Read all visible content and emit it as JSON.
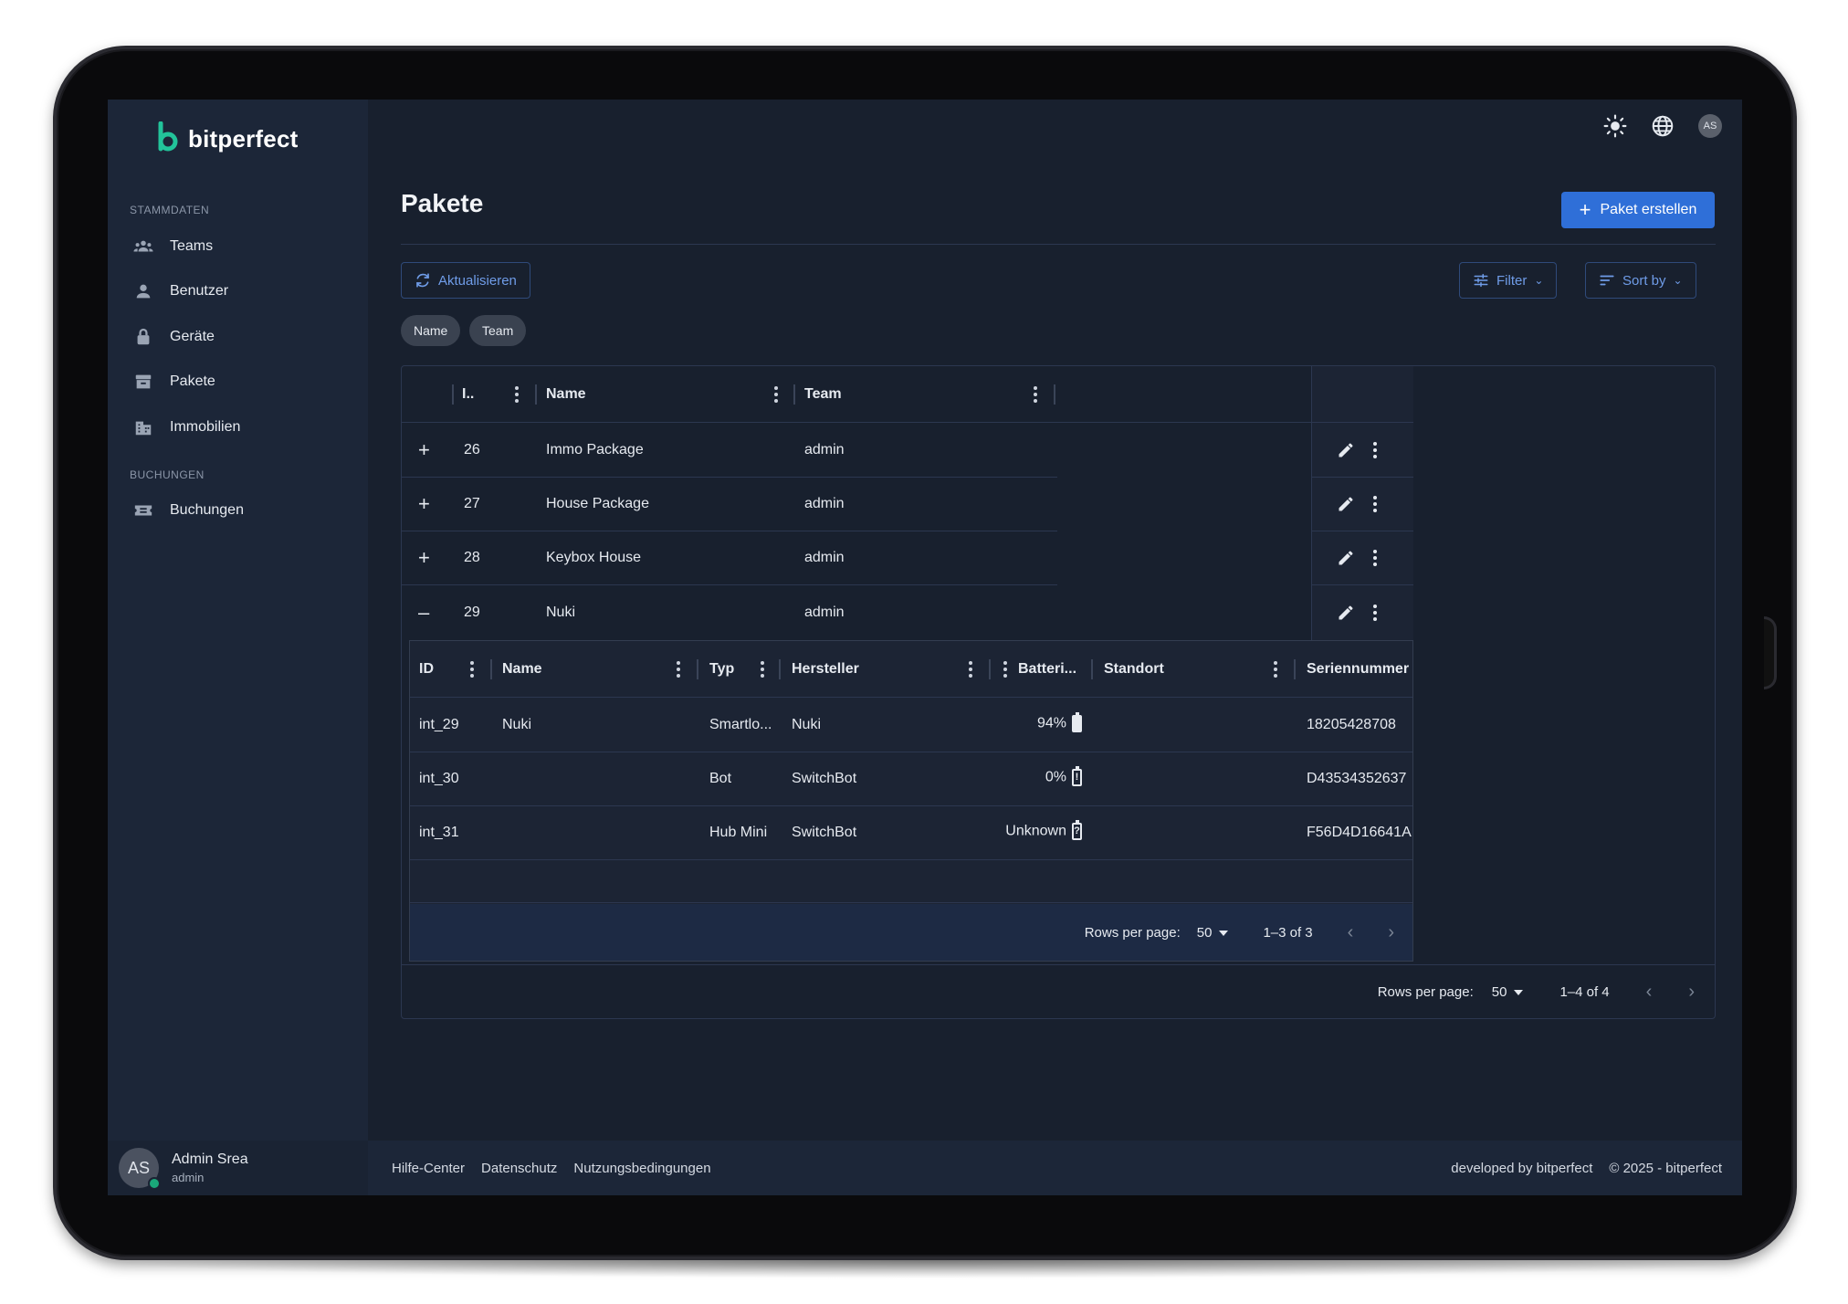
{
  "app": {
    "brand": "bitperfect",
    "user_initials": "AS"
  },
  "sidebar": {
    "sections": [
      {
        "label": "STAMMDATEN",
        "items": [
          {
            "label": "Teams",
            "icon": "teams-icon"
          },
          {
            "label": "Benutzer",
            "icon": "user-icon"
          },
          {
            "label": "Geräte",
            "icon": "lock-icon"
          },
          {
            "label": "Pakete",
            "icon": "archive-icon"
          },
          {
            "label": "Immobilien",
            "icon": "building-icon"
          }
        ]
      },
      {
        "label": "BUCHUNGEN",
        "items": [
          {
            "label": "Buchungen",
            "icon": "ticket-icon"
          }
        ]
      }
    ],
    "user": {
      "initials": "AS",
      "name": "Admin Srea",
      "role": "admin"
    }
  },
  "page": {
    "title": "Pakete",
    "create_label": "Paket erstellen",
    "refresh_label": "Aktualisieren",
    "filter_label": "Filter",
    "sort_label": "Sort by",
    "chips": [
      "Name",
      "Team"
    ]
  },
  "table": {
    "columns": [
      "I..",
      "Name",
      "Team"
    ],
    "rows": [
      {
        "toggle": "+",
        "id": "26",
        "name": "Immo Package",
        "team": "admin"
      },
      {
        "toggle": "+",
        "id": "27",
        "name": "House Package",
        "team": "admin"
      },
      {
        "toggle": "+",
        "id": "28",
        "name": "Keybox House",
        "team": "admin"
      },
      {
        "toggle": "–",
        "id": "29",
        "name": "Nuki",
        "team": "admin"
      }
    ],
    "footer": {
      "rows_per_page_label": "Rows per page:",
      "rows_per_page": "50",
      "range": "1–4 of 4"
    }
  },
  "nested_table": {
    "columns": [
      "ID",
      "Name",
      "Typ",
      "Hersteller",
      "Batteri...",
      "Standort",
      "Seriennummer"
    ],
    "rows": [
      {
        "id": "int_29",
        "name": "Nuki",
        "type": "Smartlo...",
        "vendor": "Nuki",
        "battery": "94%",
        "battery_icon": "full",
        "location": "",
        "serial": "18205428708"
      },
      {
        "id": "int_30",
        "name": "",
        "type": "Bot",
        "vendor": "SwitchBot",
        "battery": "0%",
        "battery_icon": "alert",
        "location": "",
        "serial": "D43534352637"
      },
      {
        "id": "int_31",
        "name": "",
        "type": "Hub Mini",
        "vendor": "SwitchBot",
        "battery": "Unknown",
        "battery_icon": "unknown",
        "location": "",
        "serial": "F56D4D16641A"
      }
    ],
    "footer": {
      "rows_per_page_label": "Rows per page:",
      "rows_per_page": "50",
      "range": "1–3 of 3"
    }
  },
  "footer": {
    "links": [
      "Hilfe-Center",
      "Datenschutz",
      "Nutzungsbedingungen"
    ],
    "developed_by": "developed by bitperfect",
    "copyright": "© 2025 - bitperfect"
  },
  "colors": {
    "accent": "#2f6fd8",
    "background": "#18202e",
    "sidebar": "#1c2638",
    "brand_green": "#22c39a"
  }
}
